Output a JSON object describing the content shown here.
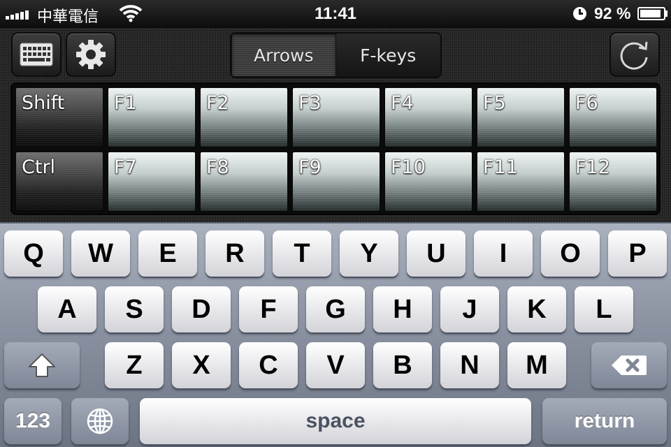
{
  "status_bar": {
    "carrier": "中華電信",
    "time": "11:41",
    "battery_text": "92 %",
    "battery_level": 0.92,
    "icons": [
      "signal-bars-icon",
      "wifi-icon",
      "clock-icon",
      "battery-icon"
    ]
  },
  "toolbar": {
    "keyboard_icon": "keyboard-icon",
    "settings_icon": "gear-icon",
    "refresh_icon": "refresh-icon",
    "tabs": [
      {
        "label": "Arrows",
        "selected": true
      },
      {
        "label": "F-keys",
        "selected": false
      }
    ]
  },
  "function_keys": {
    "row1": [
      "Shift",
      "F1",
      "F2",
      "F3",
      "F4",
      "F5",
      "F6"
    ],
    "row2": [
      "Ctrl",
      "F7",
      "F8",
      "F9",
      "F10",
      "F11",
      "F12"
    ]
  },
  "keyboard": {
    "row1": [
      "Q",
      "W",
      "E",
      "R",
      "T",
      "Y",
      "U",
      "I",
      "O",
      "P"
    ],
    "row2": [
      "A",
      "S",
      "D",
      "F",
      "G",
      "H",
      "J",
      "K",
      "L"
    ],
    "row3": [
      "Z",
      "X",
      "C",
      "V",
      "B",
      "N",
      "M"
    ],
    "numbers_label": "123",
    "space_label": "space",
    "return_label": "return",
    "shift_icon": "shift-arrow-icon",
    "delete_icon": "backspace-icon",
    "globe_icon": "globe-icon"
  },
  "colors": {
    "keyboard_bg": "#8b93a2",
    "key_face": "#f2f2f4",
    "fkey_face": "#c4cecd"
  }
}
